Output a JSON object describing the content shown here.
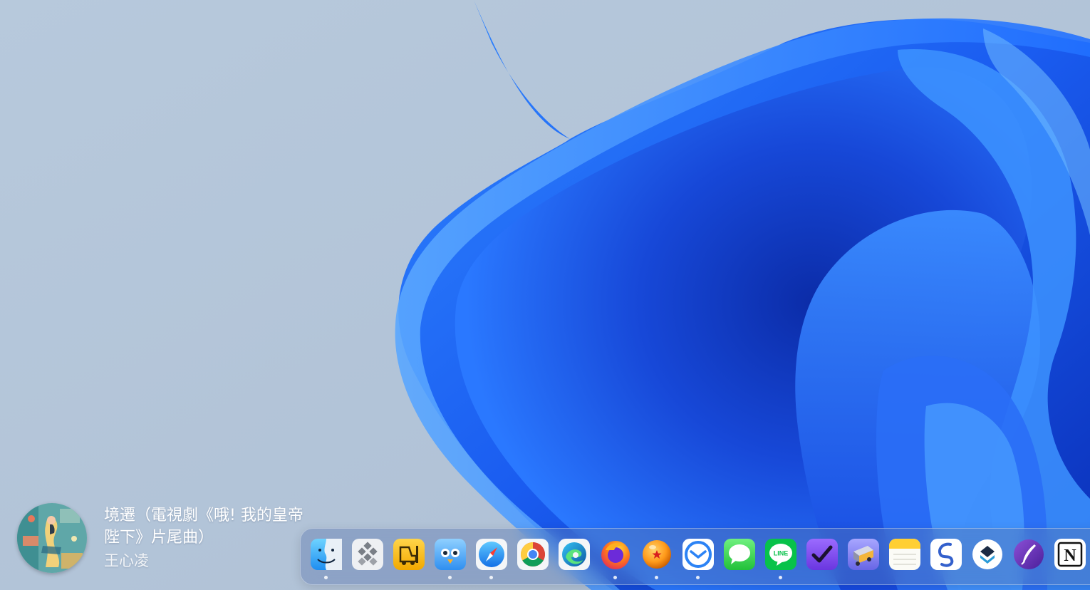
{
  "now_playing": {
    "title": "境遷（電視劇《哦! 我的皇帝陛下》片尾曲）",
    "artist": "王心凌",
    "album_art_icon": "album-art"
  },
  "dock": {
    "items": [
      {
        "name": "finder",
        "icon": "finder-icon",
        "running": true
      },
      {
        "name": "launchpad",
        "icon": "launchpad-icon",
        "running": false
      },
      {
        "name": "forklift",
        "icon": "forklift-icon",
        "running": false
      },
      {
        "name": "tweetbot",
        "icon": "tweetbot-icon",
        "running": true
      },
      {
        "name": "safari",
        "icon": "safari-icon",
        "running": true
      },
      {
        "name": "chrome",
        "icon": "chrome-icon",
        "running": false
      },
      {
        "name": "edge",
        "icon": "edge-icon",
        "running": false
      },
      {
        "name": "firefox",
        "icon": "firefox-icon",
        "running": true
      },
      {
        "name": "dragon-ball",
        "icon": "dragonball-icon",
        "running": true
      },
      {
        "name": "airmail",
        "icon": "airmail-icon",
        "running": true
      },
      {
        "name": "messages",
        "icon": "messages-icon",
        "running": false
      },
      {
        "name": "line",
        "icon": "line-icon",
        "running": true,
        "label": "LINE"
      },
      {
        "name": "omnifocus",
        "icon": "checkmark-icon",
        "running": false
      },
      {
        "name": "transmit",
        "icon": "transmit-icon",
        "running": false
      },
      {
        "name": "notes",
        "icon": "notes-icon",
        "running": false
      },
      {
        "name": "simplenote",
        "icon": "simplenote-icon",
        "running": false
      },
      {
        "name": "copilot",
        "icon": "layers-icon",
        "running": false
      },
      {
        "name": "quill",
        "icon": "quill-icon",
        "running": false
      },
      {
        "name": "notion",
        "icon": "notion-icon",
        "running": false,
        "label": "N"
      }
    ]
  },
  "colors": {
    "wallpaper_bg": "#b3c6db",
    "wallpaper_blue": "#1f6bff"
  }
}
